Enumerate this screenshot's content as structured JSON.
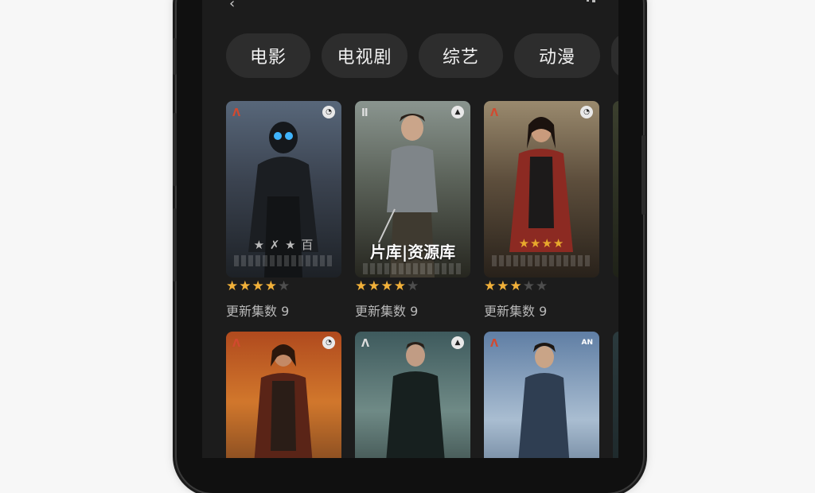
{
  "status": {
    "back_glyph": "‹"
  },
  "tabs": [
    {
      "label": "电影"
    },
    {
      "label": "电视剧"
    },
    {
      "label": "综艺"
    },
    {
      "label": "动漫"
    },
    {
      "label": ""
    }
  ],
  "rows": [
    {
      "cards": [
        {
          "rating": 4,
          "rating_max": 5,
          "meta": "更新集数 9",
          "poster_overlay": "",
          "poster_stars": "★ ✗ ★ 百"
        },
        {
          "rating": 4,
          "rating_max": 5,
          "meta": "更新集数 9",
          "poster_overlay": "片库|资源库",
          "poster_stars": ""
        },
        {
          "rating": 3,
          "rating_max": 5,
          "meta": "更新集数 9",
          "poster_overlay": "",
          "poster_stars": "★★★★"
        }
      ]
    },
    {
      "cards": [
        {
          "poster_overlay": ""
        },
        {
          "poster_overlay": ""
        },
        {
          "poster_overlay": ""
        }
      ]
    }
  ],
  "colors": {
    "accent_star": "#f2b13a",
    "background": "#1c1c1c",
    "tab_bg": "#2d2d2d"
  },
  "icons": {
    "back": "back-arrow-icon",
    "rating": "star-icon"
  }
}
